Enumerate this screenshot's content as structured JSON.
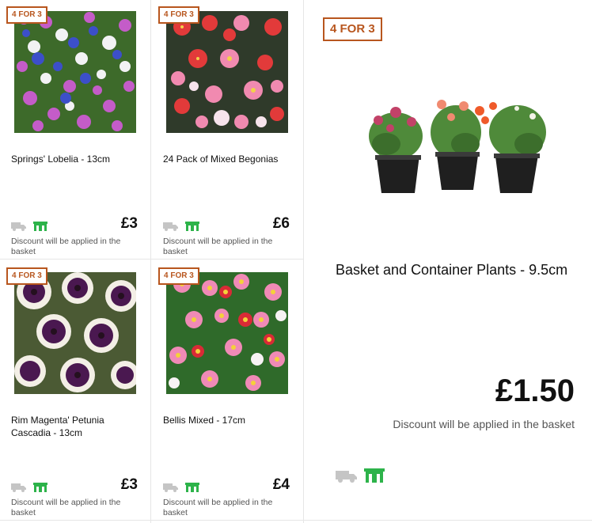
{
  "badge": "4 FOR 3",
  "products": [
    {
      "title": "Springs' Lobelia - 13cm",
      "price": "£3",
      "discount": "Discount will be applied in the basket"
    },
    {
      "title": "24 Pack of Mixed Begonias",
      "price": "£6",
      "discount": "Discount will be applied in the basket"
    },
    {
      "title": "Rim Magenta' Petunia Cascadia - 13cm",
      "price": "£3",
      "discount": "Discount will be applied in the basket"
    },
    {
      "title": "Bellis Mixed - 17cm",
      "price": "£4",
      "discount": "Discount will be applied in the basket"
    }
  ],
  "feature": {
    "title": "Basket and Container Plants - 9.5cm",
    "price": "£1.50",
    "discount": "Discount will be applied in the basket"
  },
  "colors": {
    "badge": "#b8561e",
    "store_icon": "#2db34a",
    "delivery_icon": "#bdbdbd"
  }
}
